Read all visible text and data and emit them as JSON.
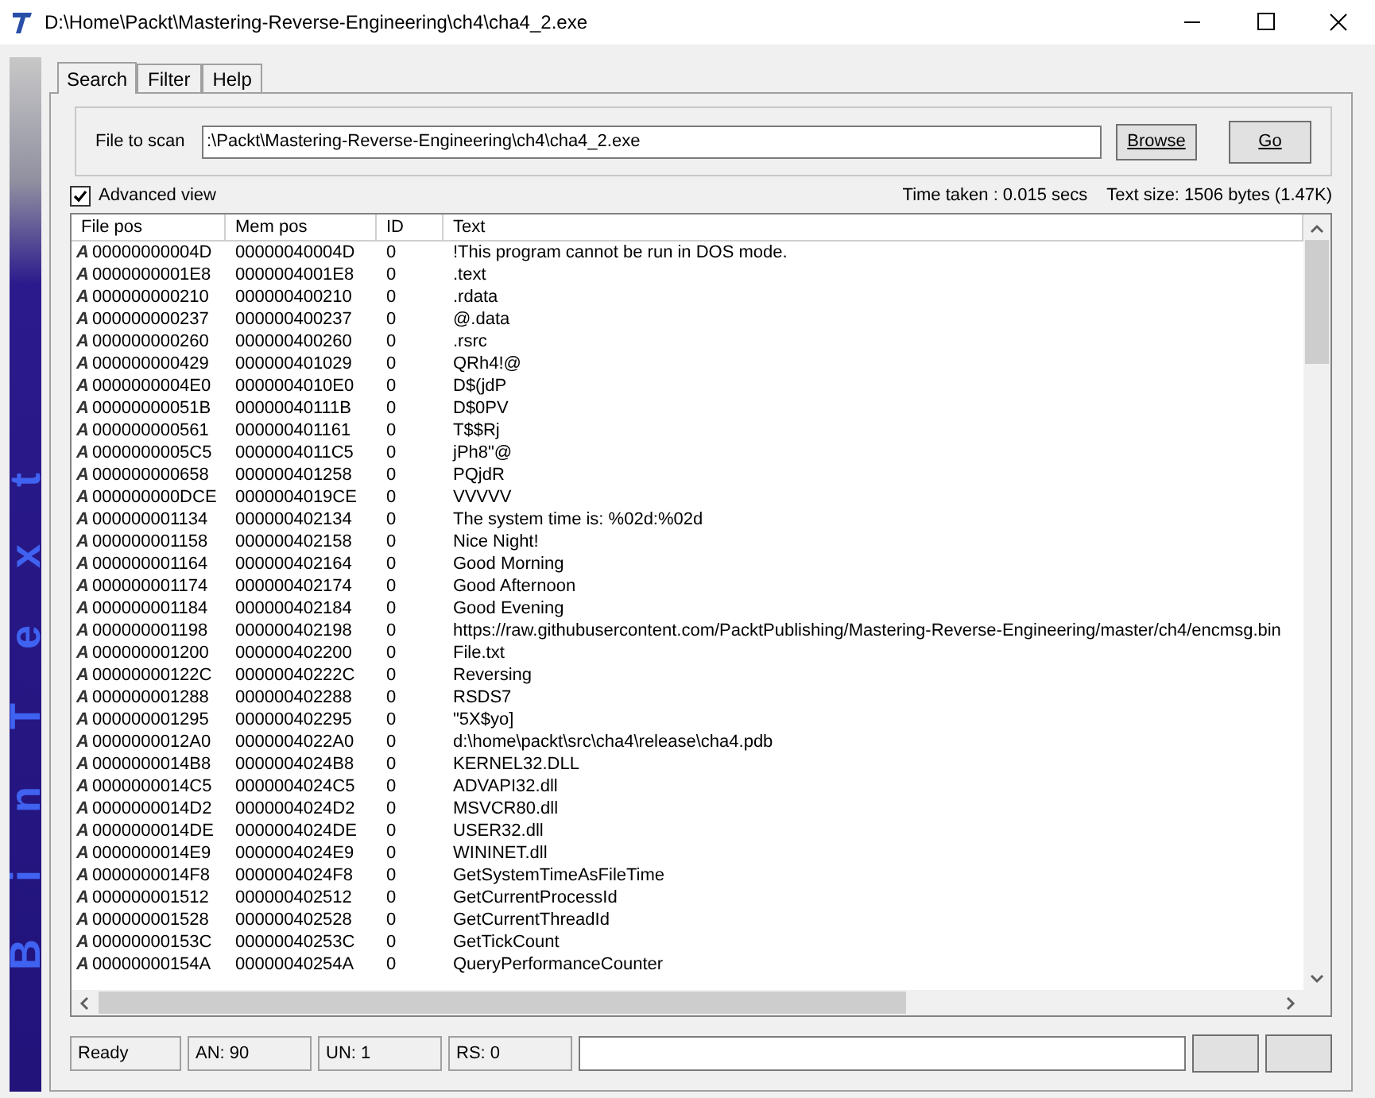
{
  "window": {
    "title": "D:\\Home\\Packt\\Mastering-Reverse-Engineering\\ch4\\cha4_2.exe"
  },
  "logo": "BinText",
  "tabs": [
    {
      "label": "Search",
      "selected": true
    },
    {
      "label": "Filter",
      "selected": false
    },
    {
      "label": "Help",
      "selected": false
    }
  ],
  "file_to_scan": {
    "label": "File to scan",
    "value": ":\\Packt\\Mastering-Reverse-Engineering\\ch4\\cha4_2.exe"
  },
  "buttons": [
    "Browse",
    "Go"
  ],
  "advanced_view": {
    "label": "Advanced view",
    "checked": true
  },
  "time_taken": "Time taken : 0.015 secs",
  "text_size": "Text size: 1506 bytes (1.47K)",
  "table": {
    "columns": [
      "File pos",
      "Mem pos",
      "ID",
      "Text"
    ],
    "rows": [
      {
        "type": "A",
        "cells": [
          "00000000004D",
          "00000040004D",
          "0",
          "!This program cannot be run in DOS mode."
        ]
      },
      {
        "type": "A",
        "cells": [
          "0000000001E8",
          "0000004001E8",
          "0",
          ".text"
        ]
      },
      {
        "type": "A",
        "cells": [
          "000000000210",
          "000000400210",
          "0",
          ".rdata"
        ]
      },
      {
        "type": "A",
        "cells": [
          "000000000237",
          "000000400237",
          "0",
          "@.data"
        ]
      },
      {
        "type": "A",
        "cells": [
          "000000000260",
          "000000400260",
          "0",
          ".rsrc"
        ]
      },
      {
        "type": "A",
        "cells": [
          "000000000429",
          "000000401029",
          "0",
          "QRh4!@"
        ]
      },
      {
        "type": "A",
        "cells": [
          "0000000004E0",
          "0000004010E0",
          "0",
          "D$(jdP"
        ]
      },
      {
        "type": "A",
        "cells": [
          "00000000051B",
          "00000040111B",
          "0",
          "D$0PV"
        ]
      },
      {
        "type": "A",
        "cells": [
          "000000000561",
          "000000401161",
          "0",
          "T$$Rj"
        ]
      },
      {
        "type": "A",
        "cells": [
          "0000000005C5",
          "0000004011C5",
          "0",
          "jPh8\"@"
        ]
      },
      {
        "type": "A",
        "cells": [
          "000000000658",
          "000000401258",
          "0",
          "PQjdR"
        ]
      },
      {
        "type": "A",
        "cells": [
          "000000000DCE",
          "0000004019CE",
          "0",
          "VVVVV"
        ]
      },
      {
        "type": "A",
        "cells": [
          "000000001134",
          "000000402134",
          "0",
          "The system time is: %02d:%02d"
        ]
      },
      {
        "type": "A",
        "cells": [
          "000000001158",
          "000000402158",
          "0",
          "Nice Night!"
        ]
      },
      {
        "type": "A",
        "cells": [
          "000000001164",
          "000000402164",
          "0",
          "Good Morning"
        ]
      },
      {
        "type": "A",
        "cells": [
          "000000001174",
          "000000402174",
          "0",
          "Good Afternoon"
        ]
      },
      {
        "type": "A",
        "cells": [
          "000000001184",
          "000000402184",
          "0",
          "Good Evening"
        ]
      },
      {
        "type": "A",
        "cells": [
          "000000001198",
          "000000402198",
          "0",
          "https://raw.githubusercontent.com/PacktPublishing/Mastering-Reverse-Engineering/master/ch4/encmsg.bin"
        ]
      },
      {
        "type": "A",
        "cells": [
          "000000001200",
          "000000402200",
          "0",
          "File.txt"
        ]
      },
      {
        "type": "A",
        "cells": [
          "00000000122C",
          "00000040222C",
          "0",
          "Reversing"
        ]
      },
      {
        "type": "A",
        "cells": [
          "000000001288",
          "000000402288",
          "0",
          "RSDS7"
        ]
      },
      {
        "type": "A",
        "cells": [
          "000000001295",
          "000000402295",
          "0",
          "\"5X$yo]"
        ]
      },
      {
        "type": "A",
        "cells": [
          "0000000012A0",
          "0000004022A0",
          "0",
          "d:\\home\\packt\\src\\cha4\\release\\cha4.pdb"
        ]
      },
      {
        "type": "A",
        "cells": [
          "0000000014B8",
          "0000004024B8",
          "0",
          "KERNEL32.DLL"
        ]
      },
      {
        "type": "A",
        "cells": [
          "0000000014C5",
          "0000004024C5",
          "0",
          "ADVAPI32.dll"
        ]
      },
      {
        "type": "A",
        "cells": [
          "0000000014D2",
          "0000004024D2",
          "0",
          "MSVCR80.dll"
        ]
      },
      {
        "type": "A",
        "cells": [
          "0000000014DE",
          "0000004024DE",
          "0",
          "USER32.dll"
        ]
      },
      {
        "type": "A",
        "cells": [
          "0000000014E9",
          "0000004024E9",
          "0",
          "WININET.dll"
        ]
      },
      {
        "type": "A",
        "cells": [
          "0000000014F8",
          "0000004024F8",
          "0",
          "GetSystemTimeAsFileTime"
        ]
      },
      {
        "type": "A",
        "cells": [
          "000000001512",
          "000000402512",
          "0",
          "GetCurrentProcessId"
        ]
      },
      {
        "type": "A",
        "cells": [
          "000000001528",
          "000000402528",
          "0",
          "GetCurrentThreadId"
        ]
      },
      {
        "type": "A",
        "cells": [
          "00000000153C",
          "00000040253C",
          "0",
          "GetTickCount"
        ]
      },
      {
        "type": "A",
        "cells": [
          "00000000154A",
          "00000040254A",
          "0",
          "QueryPerformanceCounter"
        ]
      }
    ]
  },
  "status_bar": [
    "Ready",
    "AN: 90",
    "UN: 1",
    "RS: 0"
  ]
}
